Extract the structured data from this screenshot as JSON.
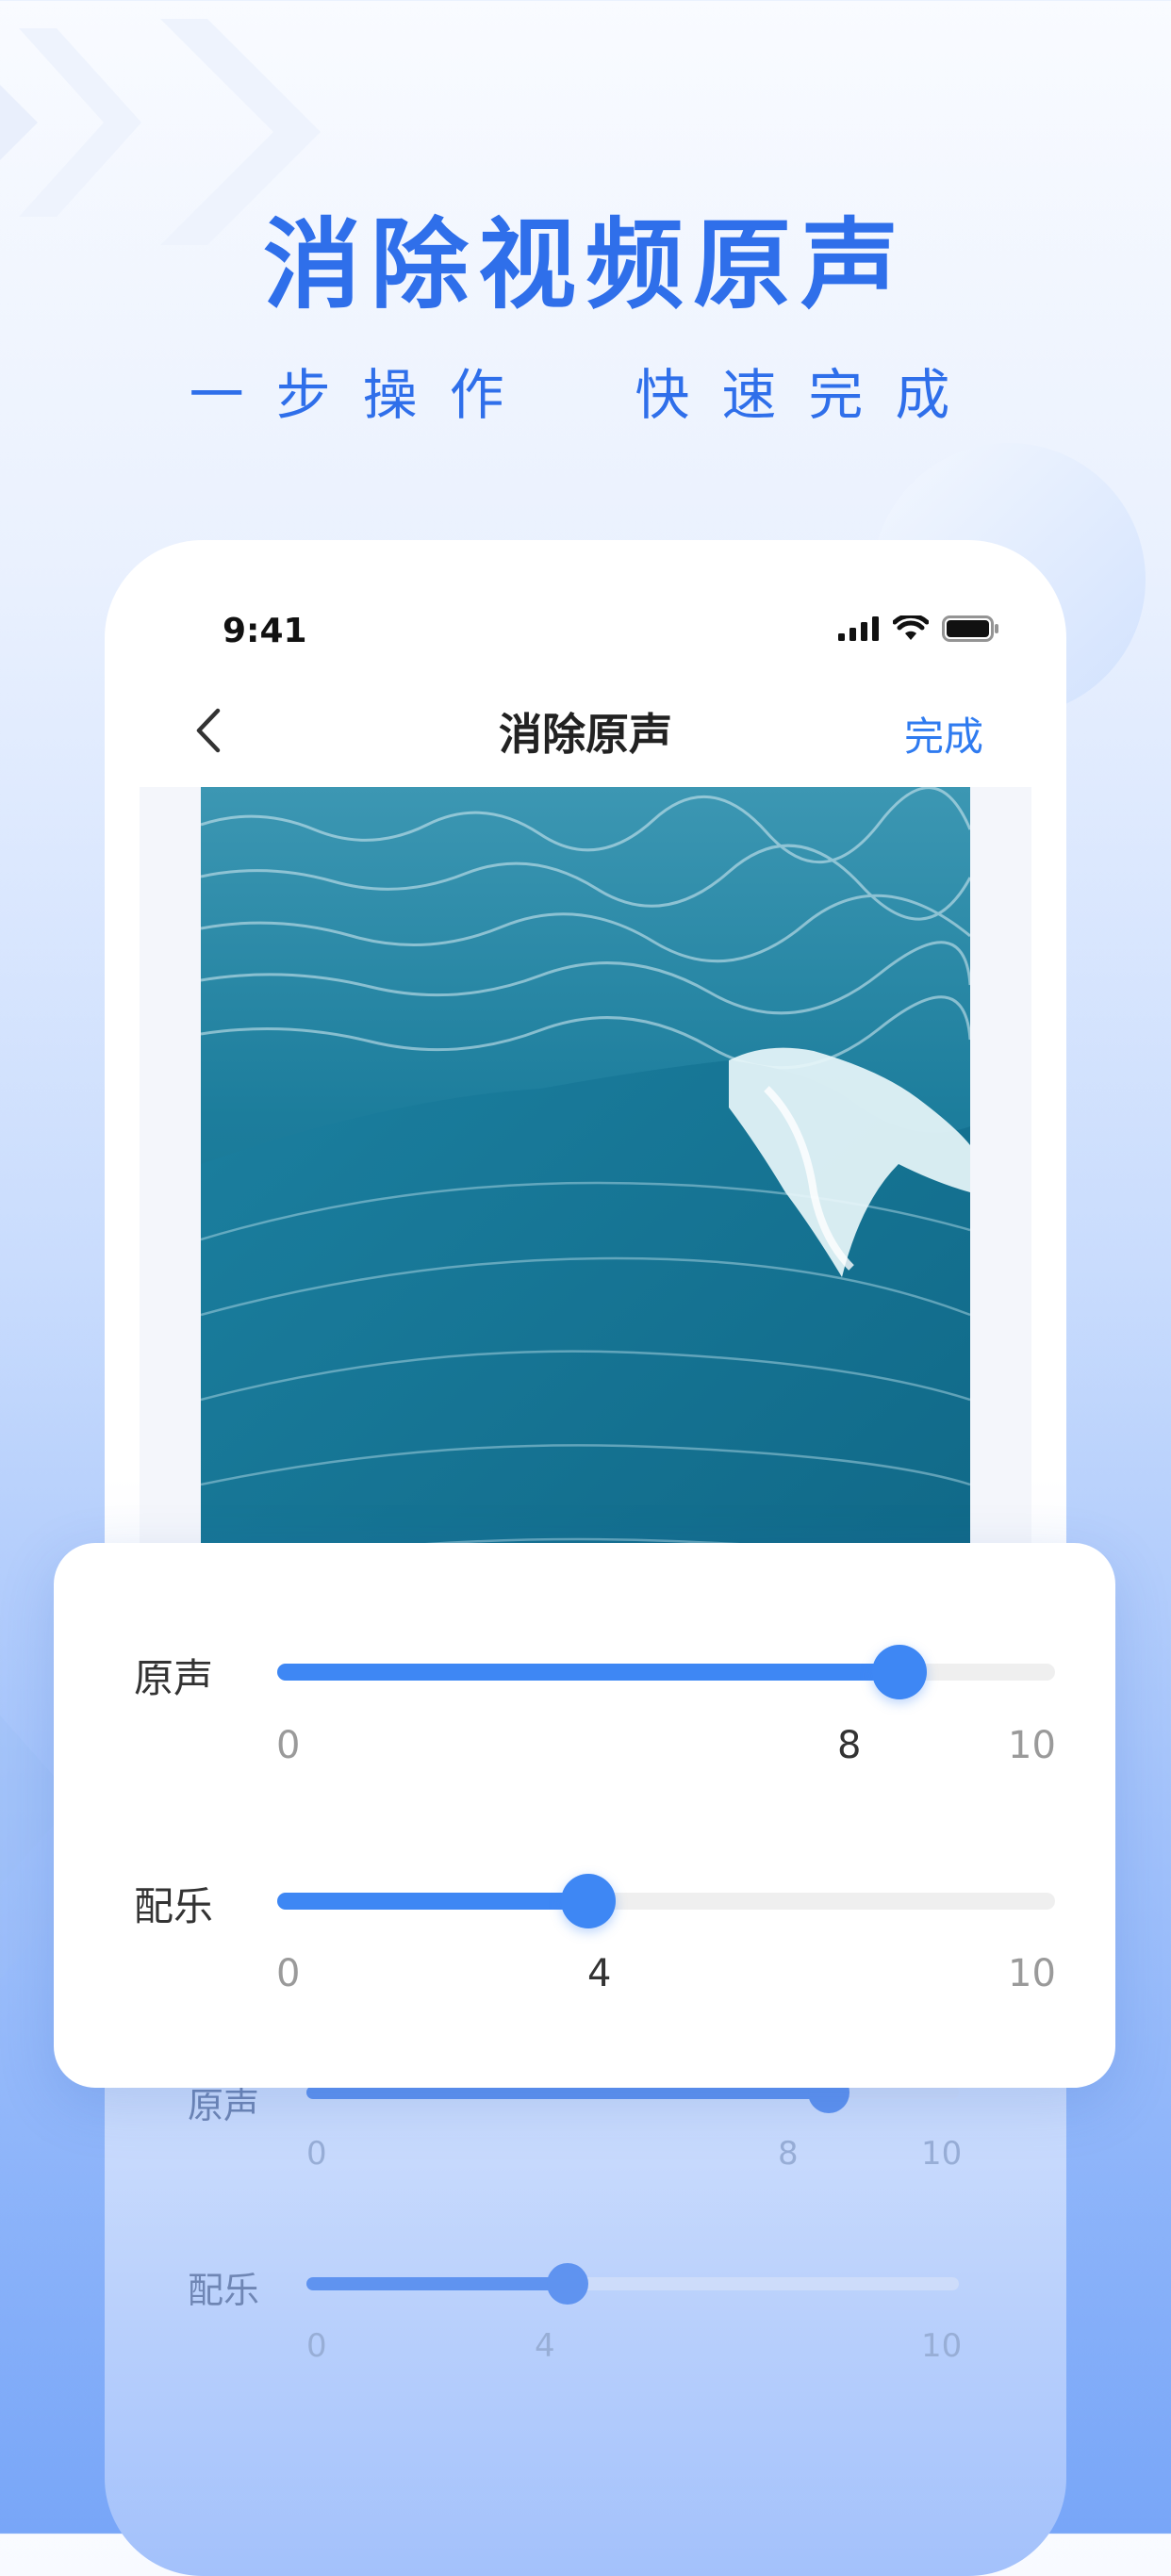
{
  "headline": "消除视频原声",
  "subline": "一步操作  快速完成",
  "phone": {
    "status": {
      "time": "9:41"
    },
    "nav": {
      "title": "消除原声",
      "done": "完成"
    }
  },
  "sliders": [
    {
      "label": "原声",
      "min": "0",
      "max": "10",
      "value": "8",
      "fraction": 0.8
    },
    {
      "label": "配乐",
      "min": "0",
      "max": "10",
      "value": "4",
      "fraction": 0.4
    }
  ],
  "colors": {
    "accent": "#3e87f4",
    "headline": "#2f6fea"
  }
}
